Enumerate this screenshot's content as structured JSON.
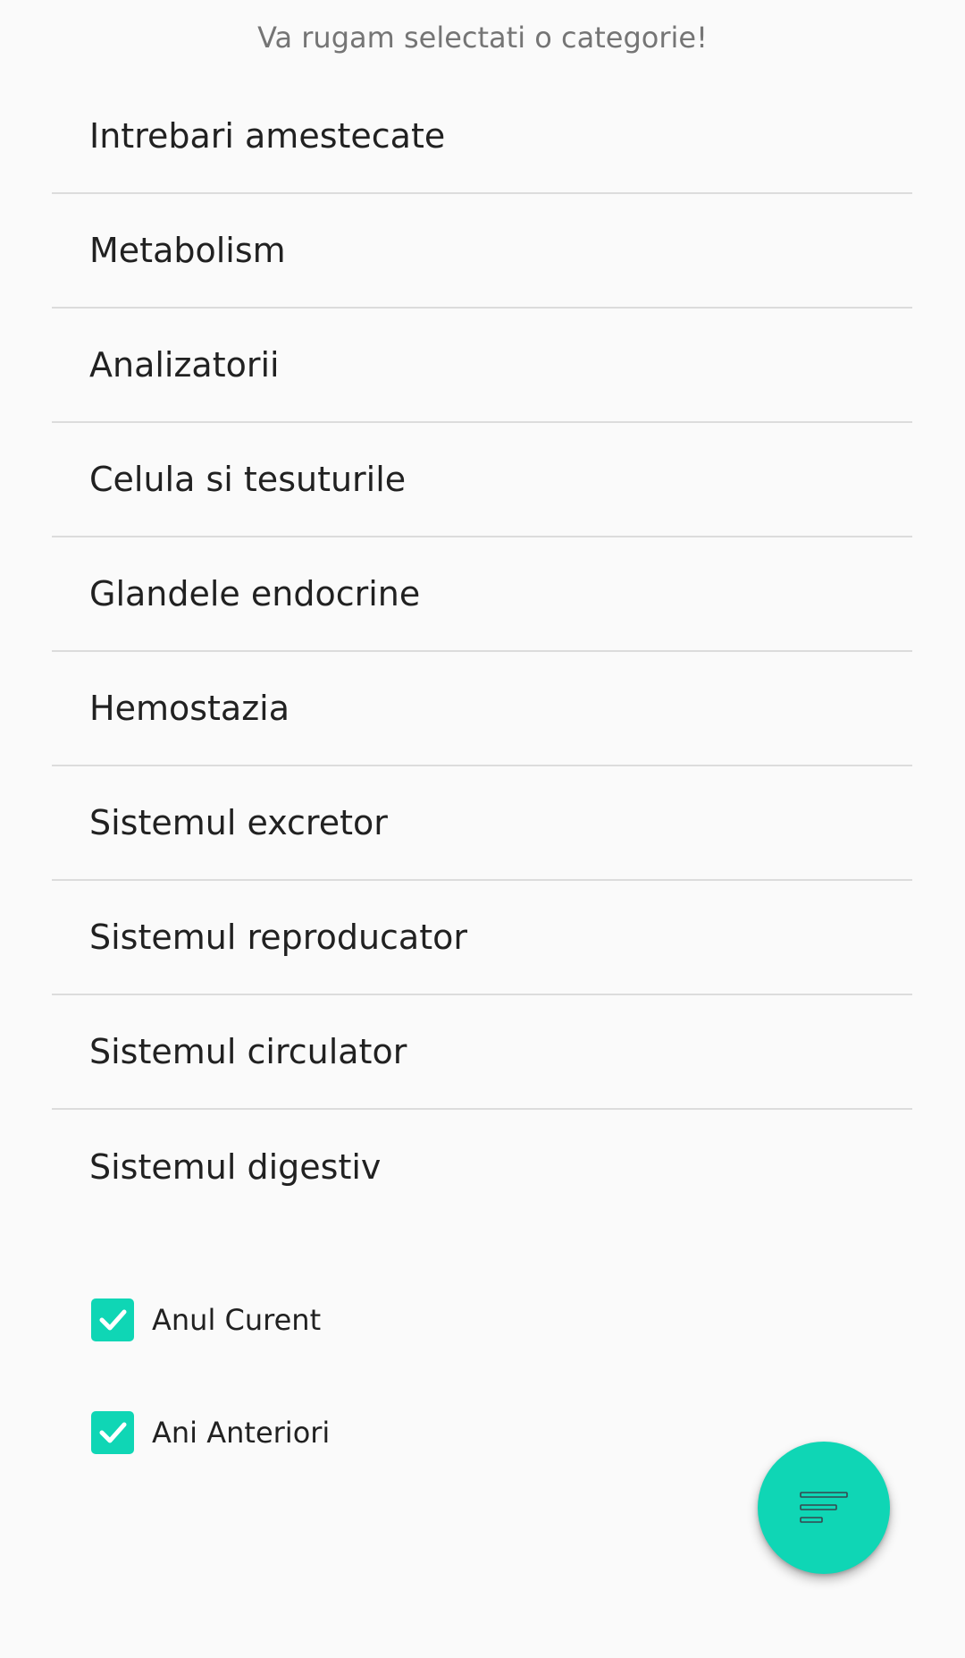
{
  "header": {
    "prompt": "Va rugam selectati o categorie!"
  },
  "categories": [
    {
      "label": "Intrebari amestecate"
    },
    {
      "label": "Metabolism"
    },
    {
      "label": "Analizatorii"
    },
    {
      "label": "Celula si tesuturile"
    },
    {
      "label": "Glandele endocrine"
    },
    {
      "label": "Hemostazia"
    },
    {
      "label": "Sistemul excretor"
    },
    {
      "label": "Sistemul reproducator"
    },
    {
      "label": "Sistemul circulator"
    },
    {
      "label": "Sistemul digestiv"
    }
  ],
  "filters": {
    "current_year": {
      "label": "Anul Curent",
      "checked": true
    },
    "previous_years": {
      "label": "Ani Anteriori",
      "checked": true
    }
  },
  "fab": {
    "icon": "filter-list-icon"
  },
  "colors": {
    "accent": "#0fd6b5",
    "background": "#fafafa",
    "divider": "#dcdcdc",
    "text_primary": "#212121",
    "text_secondary": "#757575"
  }
}
